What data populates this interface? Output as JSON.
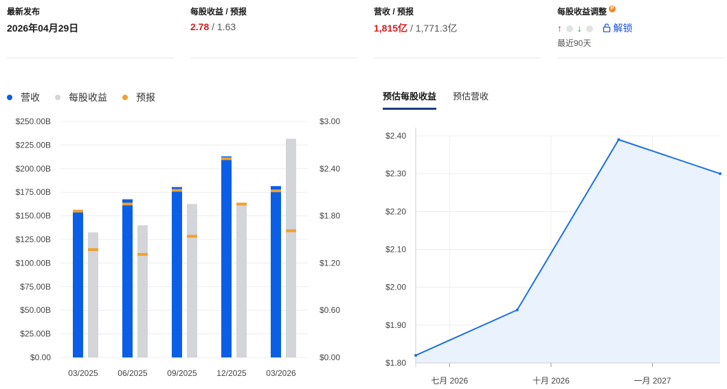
{
  "stats": {
    "latest": {
      "label": "最新发布",
      "value": "2026年04月29日"
    },
    "eps": {
      "label": "每股收益 / 预报",
      "actual": "2.78",
      "sep": "/",
      "forecast": "1.63"
    },
    "revenue": {
      "label": "营收 / 预报",
      "actual": "1,815亿",
      "sep": "/",
      "forecast": "1,771.3亿"
    },
    "adjust": {
      "label": "每股收益调整",
      "badge": "P",
      "up_arrow": "↑",
      "down_arrow": "↓",
      "unlock": "解锁",
      "period": "最近90天"
    }
  },
  "legend": [
    {
      "label": "营收",
      "color": "#0a5fe6"
    },
    {
      "label": "每股收益",
      "color": "#d3d5d8"
    },
    {
      "label": "预报",
      "color": "#f0a030"
    }
  ],
  "tabs": [
    {
      "label": "预估每股收益",
      "active": true
    },
    {
      "label": "预估营收",
      "active": false
    }
  ],
  "chart_data": [
    {
      "type": "bar",
      "categories": [
        "03/2025",
        "06/2025",
        "09/2025",
        "12/2025",
        "03/2026"
      ],
      "series": [
        {
          "name": "营收",
          "axis": "left",
          "values": [
            155.0,
            167.5,
            180.5,
            213.0,
            181.5
          ],
          "forecast": [
            155.0,
            162.5,
            177.0,
            210.5,
            176.5
          ]
        },
        {
          "name": "每股收益",
          "axis": "right",
          "values": [
            1.59,
            1.68,
            1.95,
            1.95,
            2.78
          ],
          "forecast": [
            1.37,
            1.31,
            1.54,
            1.95,
            1.61
          ]
        }
      ],
      "left_axis": {
        "ylim": [
          0,
          250
        ],
        "ticks": [
          "$0.00",
          "$25.00B",
          "$50.00B",
          "$75.00B",
          "$100.00B",
          "$125.00B",
          "$150.00B",
          "$175.00B",
          "$200.00B",
          "$225.00B",
          "$250.00B"
        ]
      },
      "right_axis": {
        "ylim": [
          0,
          3.0
        ],
        "ticks": [
          "$0.00",
          "$0.60",
          "$1.20",
          "$1.80",
          "$2.40",
          "$3.00"
        ]
      },
      "grid": true,
      "legend": "top-left"
    },
    {
      "type": "area",
      "x": [
        "2026-06",
        "2026-09",
        "2026-12",
        "2027-03"
      ],
      "values": [
        1.82,
        1.94,
        2.39,
        2.3
      ],
      "ylim": [
        1.8,
        2.4
      ],
      "y_ticks": [
        "$1.80",
        "$1.90",
        "$2.00",
        "$2.10",
        "$2.20",
        "$2.30",
        "$2.40"
      ],
      "x_ticks": [
        "七月 2026",
        "十月 2026",
        "一月 2027"
      ],
      "x_tick_dates": [
        "2026-07",
        "2026-10",
        "2027-01"
      ],
      "line_color": "#1a6ee6",
      "fill_color": "#eaf2fd",
      "grid": true
    }
  ]
}
